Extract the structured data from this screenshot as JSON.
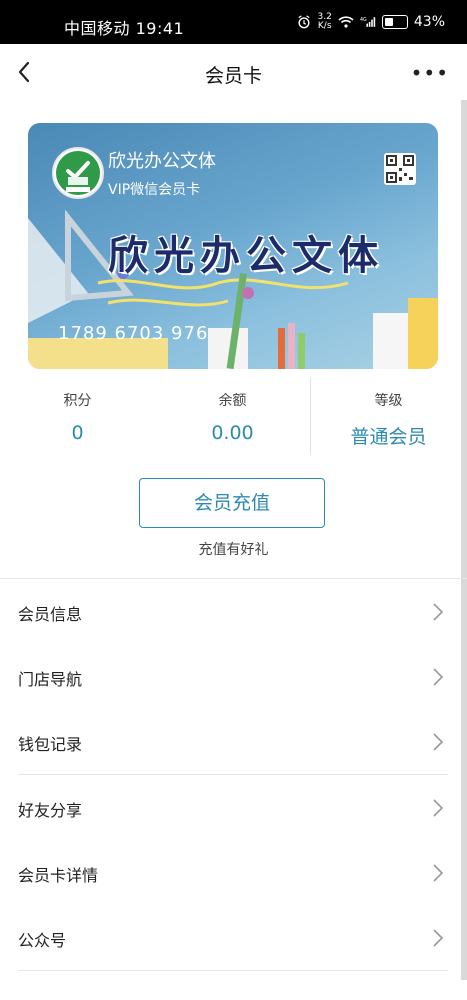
{
  "status_bar": {
    "carrier_time": "中国移动 19:41",
    "speed_value": "3.2",
    "speed_unit": "K/s",
    "network": "4G",
    "battery": "43%"
  },
  "navbar": {
    "title": "会员卡",
    "more": "•••"
  },
  "card": {
    "shop_name": "欣光办公文体",
    "card_type": "VIP微信会员卡",
    "banner_text": "欣光办公文体",
    "card_number": "1789 6703 976"
  },
  "stats": [
    {
      "label": "积分",
      "value": "0"
    },
    {
      "label": "余额",
      "value": "0.00"
    },
    {
      "label": "等级",
      "value": "普通会员"
    }
  ],
  "recharge": {
    "button_label": "会员充值",
    "note": "充值有好礼"
  },
  "menu": [
    {
      "label": "会员信息"
    },
    {
      "label": "门店导航"
    },
    {
      "label": "钱包记录"
    },
    {
      "label": "好友分享"
    },
    {
      "label": "会员卡详情"
    },
    {
      "label": "公众号"
    }
  ],
  "colors": {
    "accent": "#2e8bb0",
    "card_top": "#4a88b6",
    "card_bottom": "#a9d1e4"
  }
}
